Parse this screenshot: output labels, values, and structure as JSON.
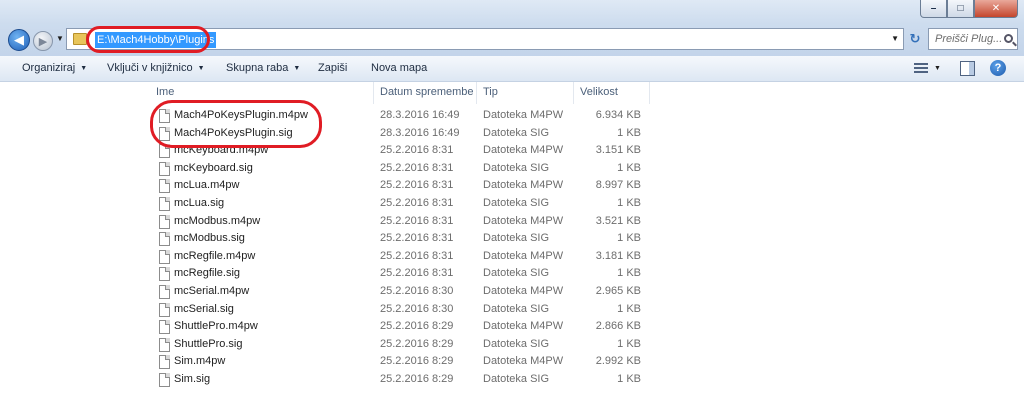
{
  "window": {
    "minimize": "–",
    "maximize": "□",
    "close": "✕"
  },
  "address": {
    "path": "E:\\Mach4Hobby\\Plugins",
    "search_placeholder": "Preišči Plug..."
  },
  "toolbar": {
    "organize": "Organiziraj",
    "include_library": "Vključi v knjižnico",
    "share": "Skupna raba",
    "burn": "Zapiši",
    "new_folder": "Nova mapa"
  },
  "columns": {
    "name": "Ime",
    "date": "Datum spremembe",
    "type": "Tip",
    "size": "Velikost"
  },
  "files": [
    {
      "name": "Mach4PoKeysPlugin.m4pw",
      "date": "28.3.2016 16:49",
      "type": "Datoteka M4PW",
      "size": "6.934 KB"
    },
    {
      "name": "Mach4PoKeysPlugin.sig",
      "date": "28.3.2016 16:49",
      "type": "Datoteka SIG",
      "size": "1 KB"
    },
    {
      "name": "mcKeyboard.m4pw",
      "date": "25.2.2016 8:31",
      "type": "Datoteka M4PW",
      "size": "3.151 KB"
    },
    {
      "name": "mcKeyboard.sig",
      "date": "25.2.2016 8:31",
      "type": "Datoteka SIG",
      "size": "1 KB"
    },
    {
      "name": "mcLua.m4pw",
      "date": "25.2.2016 8:31",
      "type": "Datoteka M4PW",
      "size": "8.997 KB"
    },
    {
      "name": "mcLua.sig",
      "date": "25.2.2016 8:31",
      "type": "Datoteka SIG",
      "size": "1 KB"
    },
    {
      "name": "mcModbus.m4pw",
      "date": "25.2.2016 8:31",
      "type": "Datoteka M4PW",
      "size": "3.521 KB"
    },
    {
      "name": "mcModbus.sig",
      "date": "25.2.2016 8:31",
      "type": "Datoteka SIG",
      "size": "1 KB"
    },
    {
      "name": "mcRegfile.m4pw",
      "date": "25.2.2016 8:31",
      "type": "Datoteka M4PW",
      "size": "3.181 KB"
    },
    {
      "name": "mcRegfile.sig",
      "date": "25.2.2016 8:31",
      "type": "Datoteka SIG",
      "size": "1 KB"
    },
    {
      "name": "mcSerial.m4pw",
      "date": "25.2.2016 8:30",
      "type": "Datoteka M4PW",
      "size": "2.965 KB"
    },
    {
      "name": "mcSerial.sig",
      "date": "25.2.2016 8:30",
      "type": "Datoteka SIG",
      "size": "1 KB"
    },
    {
      "name": "ShuttlePro.m4pw",
      "date": "25.2.2016 8:29",
      "type": "Datoteka M4PW",
      "size": "2.866 KB"
    },
    {
      "name": "ShuttlePro.sig",
      "date": "25.2.2016 8:29",
      "type": "Datoteka SIG",
      "size": "1 KB"
    },
    {
      "name": "Sim.m4pw",
      "date": "25.2.2016 8:29",
      "type": "Datoteka M4PW",
      "size": "2.992 KB"
    },
    {
      "name": "Sim.sig",
      "date": "25.2.2016 8:29",
      "type": "Datoteka SIG",
      "size": "1 KB"
    }
  ],
  "icons": [
    "back-icon",
    "forward-icon",
    "folder-icon",
    "refresh-icon",
    "search-icon",
    "view-icon",
    "preview-pane-icon",
    "help-icon",
    "file-icon"
  ],
  "colors": {
    "highlight_oval": "#e01c24",
    "selection": "#3399ff"
  }
}
